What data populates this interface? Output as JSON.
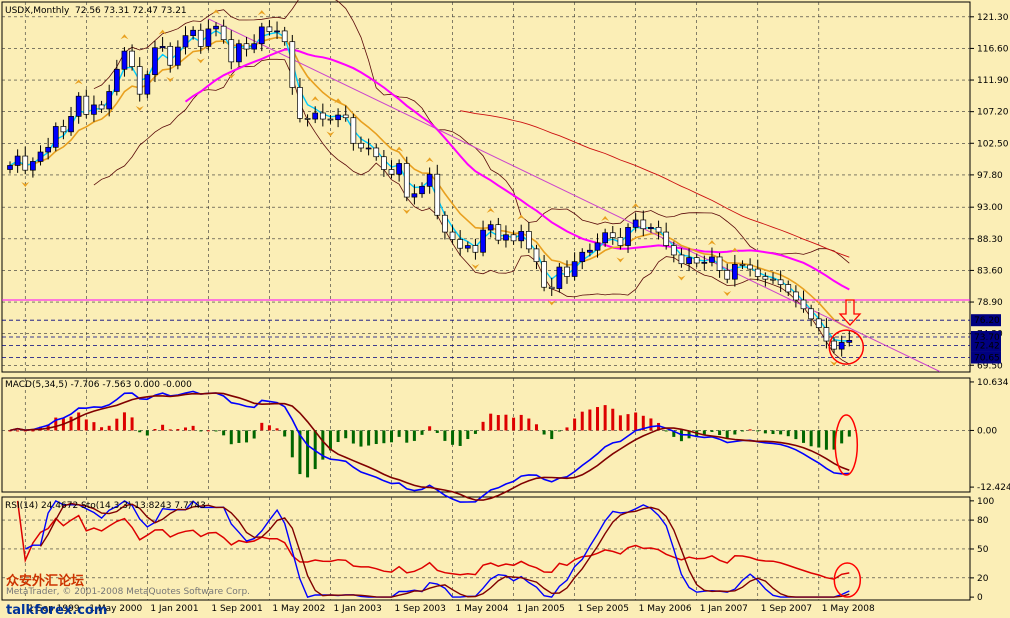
{
  "header": {
    "symbol": "USDX,Monthly",
    "ohlc": "72.56 73.31 72.47 73.21"
  },
  "macd_label": "MACD(5,34,5) -7.706 -7.563 0.000 -0.000",
  "osc_label": "RSI(14) 24.4672  Sto(14,3,3) 13.8243  7.7743",
  "watermark": "MetaTrader, © 2001-2008 MetaQuotes Software Corp.",
  "logo": {
    "cn": "众安外汇论坛",
    "en": "talkforex.com"
  },
  "colors": {
    "background": "#fbeeb6",
    "bull_candle": "#0000ff",
    "bear_candle": "#ffffff",
    "ma_fast": "#00ccff",
    "ma_mid": "#e8a020",
    "ma_slow": "#ff00ff",
    "envelope": "#5a0a0a",
    "fractal": "#e8a020",
    "macd_main": "#0000ff",
    "macd_signal": "#800000",
    "rsi": "#dd0000",
    "annotation": "#ff0000"
  },
  "chart_data": [
    {
      "type": "candlestick",
      "title": "USDX,Monthly",
      "y_ticks": [
        "121.30",
        "116.60",
        "111.90",
        "107.20",
        "102.50",
        "97.80",
        "93.00",
        "88.30",
        "83.60",
        "78.90",
        "74.20",
        "69.50"
      ],
      "ylim": [
        68.5,
        123.5
      ],
      "x_ticks": [
        "1 Sep 1999",
        "1 May 2000",
        "1 Jan 2001",
        "1 Sep 2001",
        "1 May 2002",
        "1 Jan 2003",
        "1 Sep 2003",
        "1 May 2004",
        "1 Jan 2005",
        "1 Sep 2005",
        "1 May 2006",
        "1 Jan 2007",
        "1 Sep 2007",
        "1 May 2008"
      ],
      "horizontal_lines": [
        {
          "value": 79.2,
          "style": "solid",
          "color": "#ff00ff"
        },
        {
          "value": 76.2,
          "label": "76.20",
          "style": "dashed"
        },
        {
          "value": 73.7,
          "label": "73.70",
          "style": "dashed"
        },
        {
          "value": 72.42,
          "label": "72.42",
          "style": "dashed"
        },
        {
          "value": 70.65,
          "label": "70.65",
          "style": "dashed"
        }
      ],
      "trendline": {
        "from": [
          "1 Sep 2001",
          121.0
        ],
        "to": [
          "1 May 2008",
          69.0
        ]
      },
      "annotations": [
        "red circle around latest candles",
        "red down arrow"
      ],
      "indicators": [
        "moving averages",
        "envelope bands",
        "fractals"
      ],
      "candles_source": "hand-read monthly OHLC"
    },
    {
      "type": "line",
      "title": "MACD(5,34,5)",
      "values": {
        "macd": -7.706,
        "signal": -7.563
      },
      "y_ticks": [
        "10.634",
        "0.00",
        "-12.424"
      ],
      "ylim": [
        -13.5,
        11.5
      ]
    },
    {
      "type": "line",
      "title": "RSI(14) / Stochastic(14,3,3)",
      "values": {
        "rsi": 24.4672,
        "sto_main": 13.8243,
        "sto_signal": 7.7743
      },
      "y_ticks": [
        "100",
        "80",
        "50",
        "20",
        "0"
      ],
      "ylim": [
        -3,
        104
      ],
      "levels": [
        80,
        50,
        20
      ]
    }
  ]
}
